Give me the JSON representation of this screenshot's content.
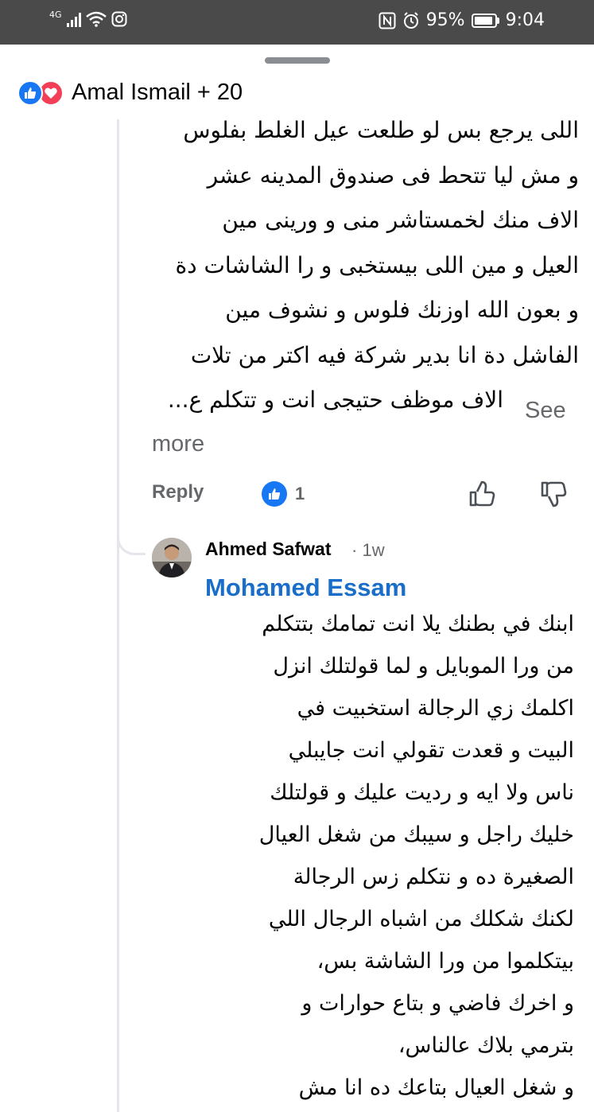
{
  "status_bar": {
    "network": "4G",
    "battery": "95%",
    "battery_level": 0.95,
    "time": "9:04"
  },
  "reactions": {
    "icons": [
      "like-icon",
      "love-icon"
    ],
    "summary": "Amal Ismail + 20"
  },
  "comment": {
    "lines": [
      "اللى يرجع بس لو طلعت عيل الغلط بفلوس",
      "و مش ليا تتحط فى صندوق المدينه عشر",
      "الاف منك لخمستاشر منى و ورينى مين",
      "العيل و مين اللى بيستخبى و را الشاشات دة",
      "و بعون الله اوزنك فلوس  و نشوف مين",
      "الفاشل دة انا بدير شركة  فيه اكتر من تلات",
      "الاف موظف حتيجى انت و تتكلم ع..."
    ],
    "see_more_a": "See",
    "see_more_b": "more",
    "reply_label": "Reply",
    "like_count": "1"
  },
  "reply": {
    "author": "Ahmed Safwat",
    "time": "1w",
    "mention": "Mohamed Essam",
    "lines": [
      "ابنك في بطنك يلا انت تمامك بتتكلم",
      "من ورا الموبايل و لما قولتلك انزل",
      "اكلمك زي الرجالة استخبيت في",
      "البيت و قعدت تقولي انت جايبلي",
      "ناس ولا ايه و رديت عليك و قولتلك",
      "خليك راجل و سيبك من شغل العيال",
      "الصغيرة ده و نتكلم زس الرجالة",
      "لكنك شكلك من اشباه الرجال اللي",
      "بيتكلموا من ورا الشاشة بس،",
      "و اخرك فاضي و بتاع حوارات و",
      "بترمي بلاك عالناس،",
      "و شغل العيال بتاعك ده انا مش"
    ]
  },
  "colors": {
    "status_bar_bg": "#4a4a4a",
    "like_blue": "#1877f2",
    "love_red": "#f33e58",
    "mention_blue": "#1a6ec9",
    "secondary_text": "#65676b"
  }
}
